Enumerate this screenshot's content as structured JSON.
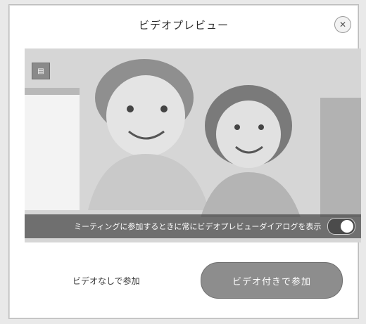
{
  "dialog": {
    "title": "ビデオプレビュー",
    "close_icon": "close-icon"
  },
  "preview": {
    "caption": "ミーティングに参加するときに常にビデオプレビューダイアログを表示",
    "toggle_on": true
  },
  "actions": {
    "no_video_label": "ビデオなしで参加",
    "join_video_label": "ビデオ付きで参加"
  }
}
